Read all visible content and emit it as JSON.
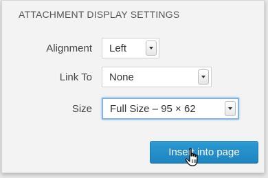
{
  "section_title": "ATTACHMENT DISPLAY SETTINGS",
  "alignment": {
    "label": "Alignment",
    "value": "Left"
  },
  "link_to": {
    "label": "Link To",
    "value": "None"
  },
  "size": {
    "label": "Size",
    "value": "Full Size – 95 × 62"
  },
  "insert_button": {
    "label": "Insert into page"
  },
  "colors": {
    "button": "#2288c8",
    "panel_bg": "#f3f3f3",
    "focus_ring": "#7fb5df"
  },
  "icons": [
    "chevron-down-icon",
    "hand-pointer-cursor-icon"
  ]
}
